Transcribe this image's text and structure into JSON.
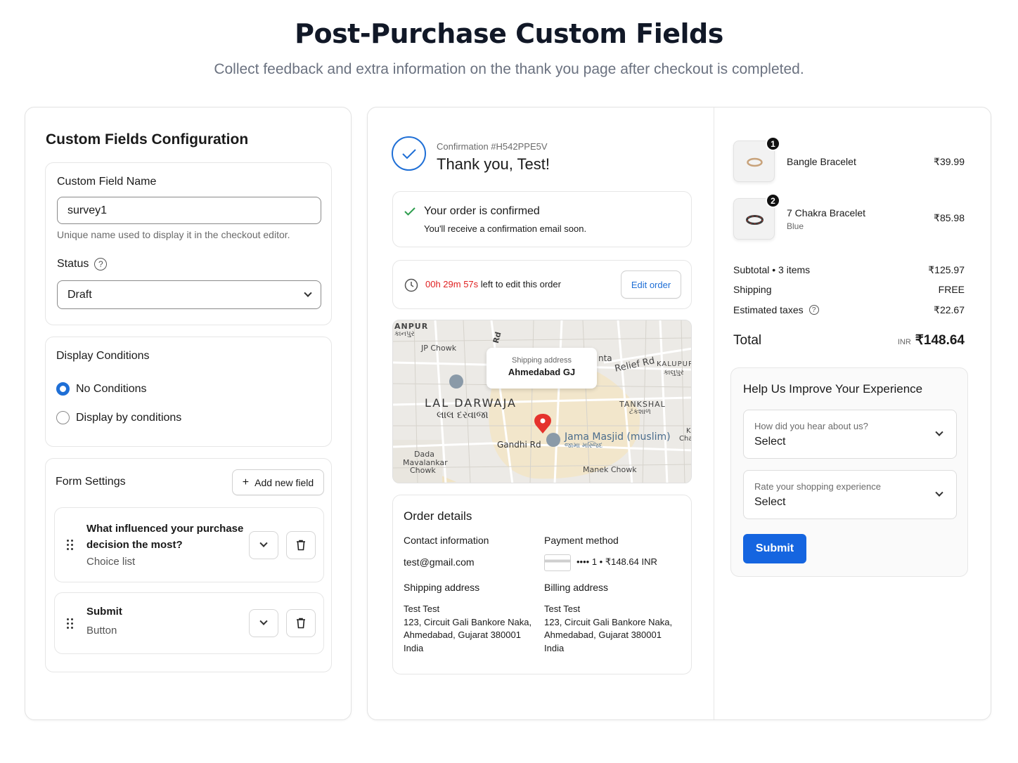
{
  "header": {
    "title": "Post-Purchase Custom Fields",
    "subtitle": "Collect feedback and extra information on the thank you page after checkout is completed."
  },
  "config": {
    "title": "Custom Fields Configuration",
    "field_name_label": "Custom Field Name",
    "field_name_value": "survey1",
    "field_name_help": "Unique name used to display it in the checkout editor.",
    "status_label": "Status",
    "status_value": "Draft",
    "display_conditions_title": "Display Conditions",
    "radio_no_conditions": "No Conditions",
    "radio_by_conditions": "Display by conditions",
    "form_settings_title": "Form Settings",
    "add_field_label": "Add new field",
    "fields": [
      {
        "title_line1": "What influenced your purchase",
        "title_line2": "decision the most?",
        "type": "Choice list"
      },
      {
        "title_line1": "Submit",
        "title_line2": "",
        "type": "Button"
      }
    ]
  },
  "checkout": {
    "confirmation_number": "Confirmation #H542PPE5V",
    "thanks": "Thank you, Test!",
    "confirmed_title": "Your order is confirmed",
    "confirmed_sub": "You'll receive a confirmation email soon.",
    "timer": "00h 29m 57s",
    "timer_suffix": "left to edit this order",
    "edit_order": "Edit order",
    "map": {
      "tooltip_label": "Shipping address",
      "tooltip_value": "Ahmedabad GJ",
      "labels": {
        "kanpur": "ANPUR",
        "kanpur_gu": "કાનપુર",
        "jp_chowk": "JP Chowk",
        "rd": "Rd",
        "nta": "nta",
        "relief_rd": "Relief Rd",
        "kalupur": "KALUPUR",
        "kalupur_gu": "કાલુપુર",
        "lal_darwaja": "LAL DARWAJA",
        "lal_darwaja_gu": "લાલ દરવાજા",
        "tankshal": "TANKSHAL",
        "tankshal_gu": "ટંકશાળ",
        "gandhi_rd": "Gandhi Rd",
        "jama_masjid": "Jama Masjid (muslim)",
        "jama_masjid_gu": "જામા મસ્જિદ",
        "dada": "Dada",
        "mavalankar": "Mavalankar",
        "chowk": "Chowk",
        "manek_chowk": "Manek Chowk",
        "k": "K",
        "cha": "Cha"
      }
    },
    "order_details_title": "Order details",
    "contact_label": "Contact information",
    "contact_value": "test@gmail.com",
    "payment_label": "Payment method",
    "payment_value": "•••• 1 • ₹148.64 INR",
    "shipping_label": "Shipping address",
    "billing_label": "Billing address",
    "address_lines": [
      "Test Test",
      "123, Circuit Gali Bankore Naka,",
      "Ahmedabad, Gujarat 380001",
      "India"
    ]
  },
  "summary": {
    "items": [
      {
        "qty": "1",
        "name": "Bangle Bracelet",
        "variant": "",
        "price": "₹39.99"
      },
      {
        "qty": "2",
        "name": "7 Chakra Bracelet",
        "variant": "Blue",
        "price": "₹85.98"
      }
    ],
    "subtotal_label": "Subtotal • 3 items",
    "subtotal_value": "₹125.97",
    "shipping_label": "Shipping",
    "shipping_value": "FREE",
    "taxes_label": "Estimated taxes",
    "taxes_value": "₹22.67",
    "total_label": "Total",
    "total_currency": "INR",
    "total_value": "₹148.64",
    "survey": {
      "title": "Help Us Improve Your Experience",
      "q1_label": "How did you hear about us?",
      "q1_value": "Select",
      "q2_label": "Rate your shopping experience",
      "q2_value": "Select",
      "submit": "Submit"
    }
  },
  "colors": {
    "accent": "#1f6fd6",
    "button": "#1565e0",
    "timer": "#e02020",
    "confirmed": "#2e9d4e"
  }
}
